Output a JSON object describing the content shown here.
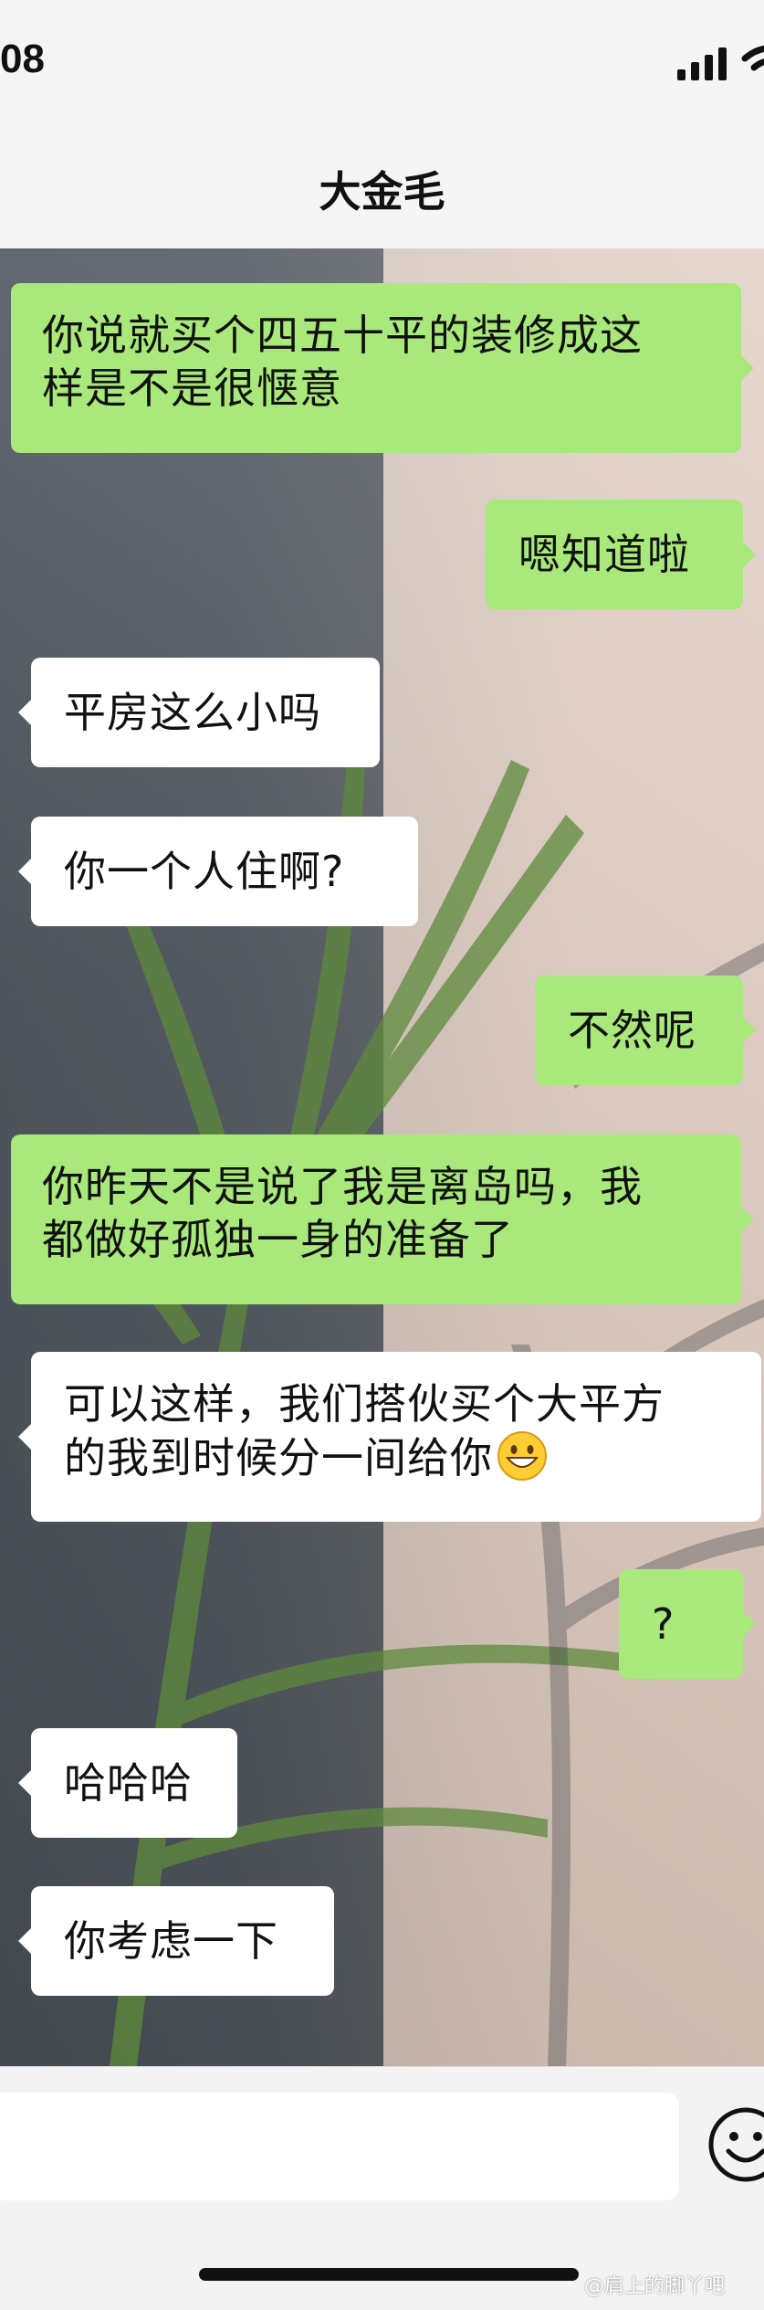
{
  "status_bar": {
    "time": "08"
  },
  "nav": {
    "title": "大金毛"
  },
  "messages": [
    {
      "side": "me",
      "line1": "你说就买个四五十平的装修成这",
      "line2": "样是不是很惬意"
    },
    {
      "side": "me",
      "line1": "嗯知道啦"
    },
    {
      "side": "other",
      "line1": "平房这么小吗"
    },
    {
      "side": "other",
      "line1": "你一个人住啊?"
    },
    {
      "side": "me",
      "line1": "不然呢"
    },
    {
      "side": "me",
      "line1": "你昨天不是说了我是离岛吗，我",
      "line2": "都做好孤独一身的准备了"
    },
    {
      "side": "other",
      "line1": "可以这样，我们搭伙买个大平方",
      "line2": "的我到时候分一间给你",
      "emoji": "grinning-face"
    },
    {
      "side": "me",
      "line1": "?"
    },
    {
      "side": "other",
      "line1": "哈哈哈"
    },
    {
      "side": "other",
      "line1": "你考虑一下"
    }
  ],
  "input_bar": {
    "placeholder": "",
    "emoji_button_icon": "smiley-icon"
  },
  "watermark": "@肩上的脚丫吧",
  "colors": {
    "my_bubble": "#a9e87a",
    "their_bubble": "#ffffff"
  }
}
